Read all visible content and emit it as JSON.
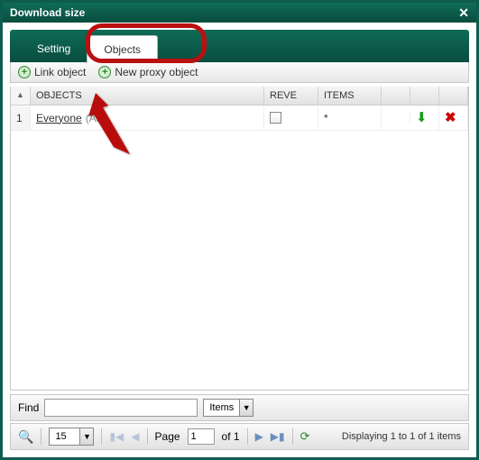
{
  "dialog": {
    "title": "Download size"
  },
  "tabs": {
    "setting": "Setting",
    "objects": "Objects"
  },
  "toolbar": {
    "link_object": "Link object",
    "new_proxy": "New proxy object"
  },
  "grid": {
    "headers": {
      "objects": "OBJECTS",
      "reve": "REVE",
      "items": "ITEMS"
    },
    "rows": [
      {
        "index": "1",
        "name": "Everyone",
        "suffix": "(All)",
        "items": "*"
      }
    ]
  },
  "find": {
    "label": "Find",
    "value": "",
    "scope": "Items"
  },
  "paging": {
    "page_size": "15",
    "page_label": "Page",
    "page_value": "1",
    "of": "of 1",
    "status": "Displaying 1 to 1 of 1 items"
  }
}
